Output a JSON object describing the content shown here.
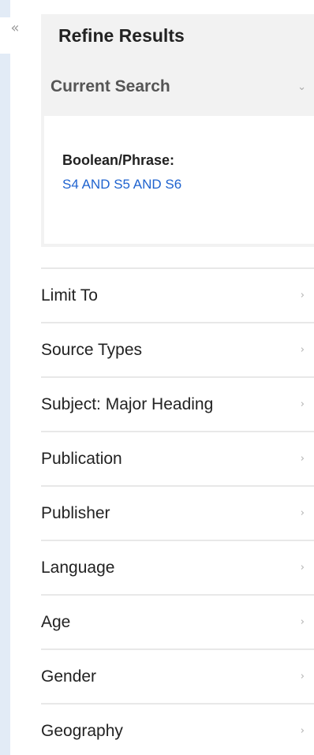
{
  "sidebar": {
    "collapse_glyph": "«",
    "title": "Refine Results",
    "current_search": {
      "label": "Current Search",
      "chevron_glyph": "⌄",
      "boolean_label": "Boolean/Phrase:",
      "boolean_value": "S4 AND S5 AND S6"
    },
    "facets": [
      {
        "label": "Limit To",
        "icon": "chevron-right-icon"
      },
      {
        "label": "Source Types",
        "icon": "chevron-right-icon"
      },
      {
        "label": "Subject: Major Heading",
        "icon": "chevron-right-icon"
      },
      {
        "label": "Publication",
        "icon": "chevron-right-icon"
      },
      {
        "label": "Publisher",
        "icon": "chevron-right-icon"
      },
      {
        "label": "Language",
        "icon": "chevron-right-icon"
      },
      {
        "label": "Age",
        "icon": "chevron-right-icon"
      },
      {
        "label": "Gender",
        "icon": "chevron-right-icon"
      },
      {
        "label": "Geography",
        "icon": "chevron-right-icon"
      }
    ],
    "chevron_right_glyph": "›"
  },
  "colors": {
    "left_strip": "#e2ebf6",
    "panel_header_bg": "#f2f2f2",
    "link": "#1f63cf",
    "divider": "#e8e8e8"
  }
}
